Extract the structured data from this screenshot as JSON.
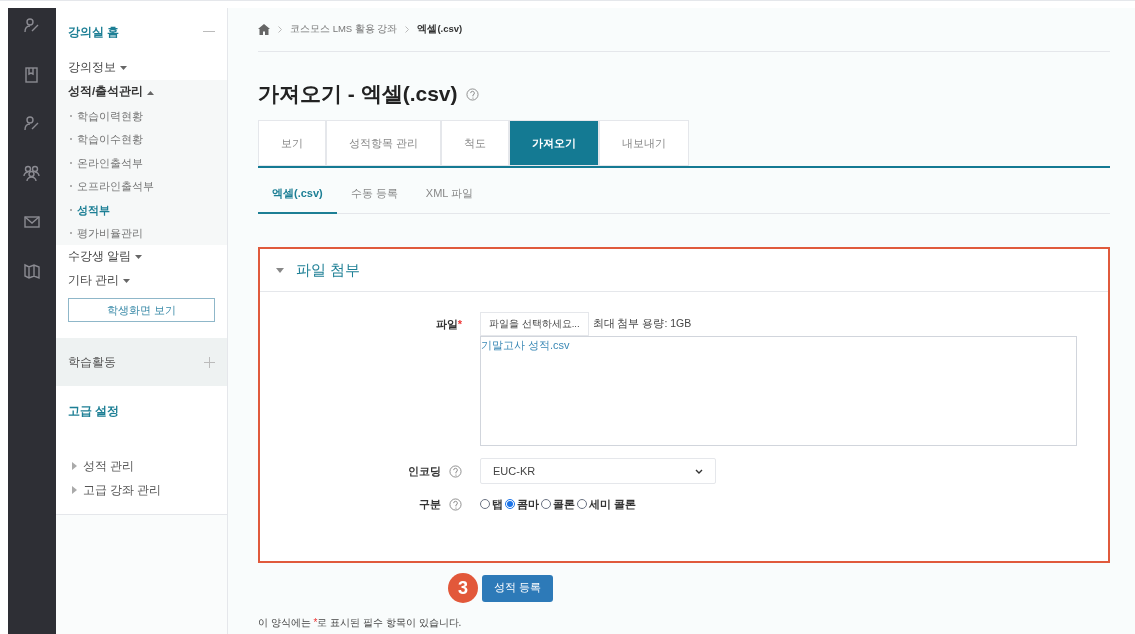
{
  "sidebar": {
    "home": {
      "label": "강의실 홈"
    },
    "menu": [
      {
        "label": "강의정보",
        "expanded": false
      },
      {
        "label": "성적/출석관리",
        "expanded": true,
        "children": [
          {
            "label": "학습이력현황",
            "selected": false
          },
          {
            "label": "학습이수현황",
            "selected": false
          },
          {
            "label": "온라인출석부",
            "selected": false
          },
          {
            "label": "오프라인출석부",
            "selected": false
          },
          {
            "label": "성적부",
            "selected": true
          },
          {
            "label": "평가비율관리",
            "selected": false
          }
        ]
      },
      {
        "label": "수강생 알림",
        "expanded": false
      },
      {
        "label": "기타 관리",
        "expanded": false
      }
    ],
    "student_view_button": "학생화면 보기",
    "activity_block": {
      "label": "학습활동"
    },
    "advanced_block": {
      "title": "고급 설정",
      "items": [
        "성적 관리",
        "고급 강좌 관리"
      ]
    }
  },
  "breadcrumb": [
    "코스모스 LMS 활용 강좌",
    "엑셀(.csv)"
  ],
  "title": "가져오기 - 엑셀(.csv)",
  "tabs": [
    {
      "label": "보기",
      "selected": false
    },
    {
      "label": "성적항목 관리",
      "selected": false
    },
    {
      "label": "척도",
      "selected": false
    },
    {
      "label": "가져오기",
      "selected": true
    },
    {
      "label": "내보내기",
      "selected": false
    }
  ],
  "subtabs": [
    {
      "label": "엑셀(.csv)",
      "selected": true
    },
    {
      "label": "수동 등록",
      "selected": false
    },
    {
      "label": "XML 파일",
      "selected": false
    }
  ],
  "section": {
    "title": "파일 첨부",
    "expanded": true,
    "file": {
      "label": "파일",
      "required_mark": "*",
      "choose_button": "파일을 선택하세요...",
      "max_size": "최대 첨부 용량: 1GB",
      "files": [
        "기말고사 성적.csv"
      ]
    },
    "encoding": {
      "label": "인코딩",
      "value": "EUC-KR"
    },
    "separator": {
      "label": "구분",
      "options": [
        {
          "label": "탭",
          "selected": false
        },
        {
          "label": "콤마",
          "selected": true
        },
        {
          "label": "콜론",
          "selected": false
        },
        {
          "label": "세미 콜론",
          "selected": false
        }
      ]
    }
  },
  "step_badge": "3",
  "submit_button": "성적 등록",
  "note": {
    "before": "이 양식에는 ",
    "mark": "*",
    "after": "로 표시된 필수 항목이 있습니다."
  }
}
